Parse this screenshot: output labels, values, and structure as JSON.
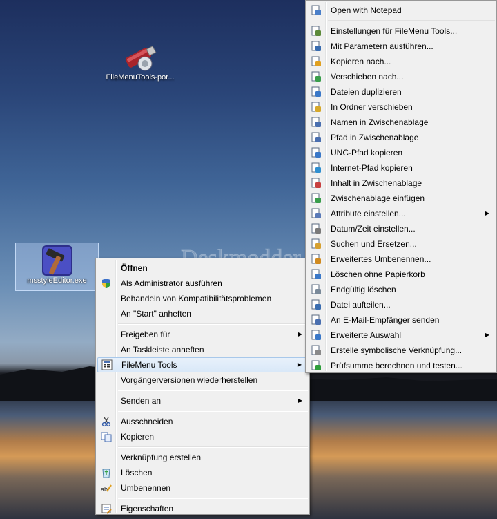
{
  "desktop": {
    "icons": [
      {
        "label": "FileMenuTools-por..."
      },
      {
        "label": "msstyleEditor.exe"
      }
    ],
    "watermark": "Deskmodder.de"
  },
  "context_menu": {
    "items": [
      {
        "label": "Öffnen",
        "bold": true,
        "icon": "none"
      },
      {
        "label": "Als Administrator ausführen",
        "icon": "uac-shield-icon"
      },
      {
        "label": "Behandeln von Kompatibilitätsproblemen",
        "icon": "none"
      },
      {
        "label": "An \"Start\" anheften",
        "icon": "none"
      },
      {
        "label": "Freigeben für",
        "icon": "none",
        "submenu": true
      },
      {
        "label": "An Taskleiste anheften",
        "icon": "none"
      },
      {
        "label": "FileMenu Tools",
        "icon": "filemenu-tools-icon",
        "submenu": true,
        "highlighted": true
      },
      {
        "label": "Vorgängerversionen wiederherstellen",
        "icon": "none"
      },
      {
        "label": "Senden an",
        "icon": "none",
        "submenu": true
      },
      {
        "label": "Ausschneiden",
        "icon": "scissors-icon"
      },
      {
        "label": "Kopieren",
        "icon": "copy-icon"
      },
      {
        "label": "Verknüpfung erstellen",
        "icon": "none"
      },
      {
        "label": "Löschen",
        "icon": "recycle-bin-icon"
      },
      {
        "label": "Umbenennen",
        "icon": "rename-icon"
      },
      {
        "label": "Eigenschaften",
        "icon": "properties-icon"
      }
    ]
  },
  "submenu": {
    "items": [
      {
        "label": "Open with Notepad",
        "icon": "notepad-icon"
      },
      {
        "label": "Einstellungen für FileMenu Tools...",
        "icon": "tools-icon"
      },
      {
        "label": "Mit Parametern ausführen...",
        "icon": "run-params-icon"
      },
      {
        "label": "Kopieren nach...",
        "icon": "copy-to-icon"
      },
      {
        "label": "Verschieben nach...",
        "icon": "move-to-icon"
      },
      {
        "label": "Dateien duplizieren",
        "icon": "duplicate-icon"
      },
      {
        "label": "In Ordner verschieben",
        "icon": "folder-move-icon"
      },
      {
        "label": "Namen in Zwischenablage",
        "icon": "name-clipboard-icon"
      },
      {
        "label": "Pfad in Zwischenablage",
        "icon": "path-clipboard-icon"
      },
      {
        "label": "UNC-Pfad kopieren",
        "icon": "unc-path-icon"
      },
      {
        "label": "Internet-Pfad kopieren",
        "icon": "internet-path-icon"
      },
      {
        "label": "Inhalt in Zwischenablage",
        "icon": "content-clipboard-icon"
      },
      {
        "label": "Zwischenablage einfügen",
        "icon": "paste-clipboard-icon"
      },
      {
        "label": "Attribute einstellen...",
        "icon": "attributes-icon",
        "submenu": true
      },
      {
        "label": "Datum/Zeit einstellen...",
        "icon": "datetime-icon"
      },
      {
        "label": "Suchen und Ersetzen...",
        "icon": "search-replace-icon"
      },
      {
        "label": "Erweitertes Umbenennen...",
        "icon": "advanced-rename-icon"
      },
      {
        "label": "Löschen ohne Papierkorb",
        "icon": "delete-no-bin-icon"
      },
      {
        "label": "Endgültig löschen",
        "icon": "shred-icon"
      },
      {
        "label": "Datei aufteilen...",
        "icon": "split-file-icon"
      },
      {
        "label": "An E-Mail-Empfänger senden",
        "icon": "email-icon"
      },
      {
        "label": "Erweiterte Auswahl",
        "icon": "advanced-select-icon",
        "submenu": true
      },
      {
        "label": "Erstelle symbolische Verknüpfung...",
        "icon": "symlink-icon"
      },
      {
        "label": "Prüfsumme berechnen und testen...",
        "icon": "checksum-icon"
      }
    ]
  }
}
